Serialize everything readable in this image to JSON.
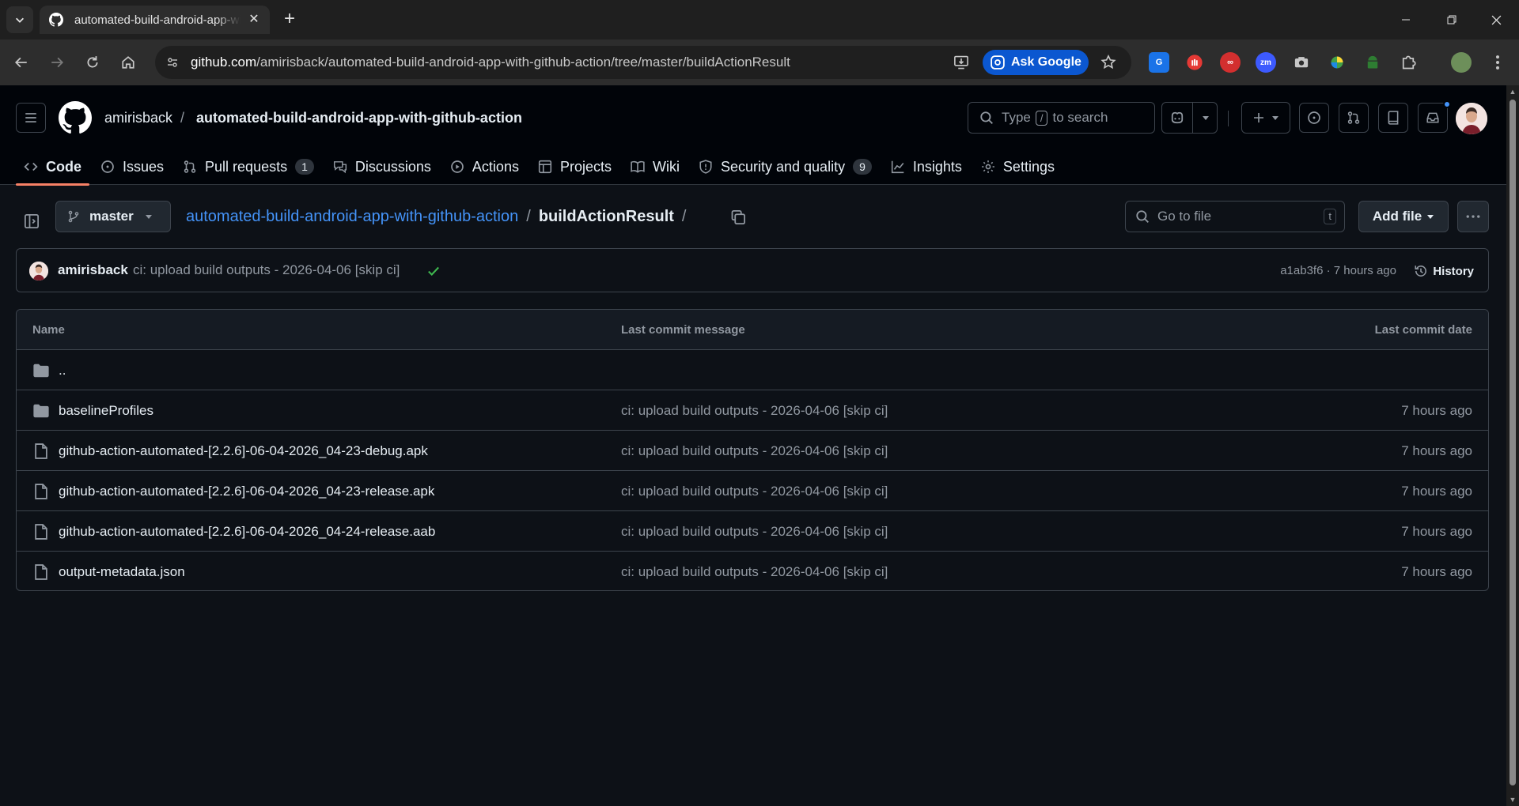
{
  "browser": {
    "tab_title": "automated-build-android-app-with-github-action",
    "url_host": "github.com",
    "url_path": "/amirisback/automated-build-android-app-with-github-action/tree/master/buildActionResult",
    "ask_google_label": "Ask Google",
    "colors": {
      "accent": "#0b57d0"
    }
  },
  "header": {
    "owner": "amirisback",
    "separator": "/",
    "repo": "automated-build-android-app-with-github-action",
    "search_prefix": "Type",
    "search_key": "/",
    "search_suffix": "to search"
  },
  "repo_nav": {
    "items": [
      {
        "label": "Code",
        "icon": "code-icon",
        "active": true
      },
      {
        "label": "Issues",
        "icon": "issue-icon"
      },
      {
        "label": "Pull requests",
        "icon": "pull-request-icon",
        "count": "1"
      },
      {
        "label": "Discussions",
        "icon": "discussion-icon"
      },
      {
        "label": "Actions",
        "icon": "play-icon"
      },
      {
        "label": "Projects",
        "icon": "table-icon"
      },
      {
        "label": "Wiki",
        "icon": "book-icon"
      },
      {
        "label": "Security and quality",
        "icon": "shield-icon",
        "count": "9"
      },
      {
        "label": "Insights",
        "icon": "graph-icon"
      },
      {
        "label": "Settings",
        "icon": "gear-icon"
      }
    ]
  },
  "breadcrumb": {
    "branch": "master",
    "repo_link": "automated-build-android-app-with-github-action",
    "sep": "/",
    "current": "buildActionResult",
    "trailing_sep": "/"
  },
  "file_actions": {
    "goto_placeholder": "Go to file",
    "goto_key": "t",
    "add_file_label": "Add file"
  },
  "latest_commit": {
    "author": "amirisback",
    "message": "ci: upload build outputs - 2026-04-06 [skip ci]",
    "sha_and_time": "a1ab3f6 · 7 hours ago",
    "history_label": "History",
    "status_color": "#3fb950"
  },
  "file_table": {
    "headers": {
      "name": "Name",
      "message": "Last commit message",
      "date": "Last commit date"
    },
    "rows": [
      {
        "type": "folder",
        "name": "..",
        "message": "",
        "date": ""
      },
      {
        "type": "folder",
        "name": "baselineProfiles",
        "message": "ci: upload build outputs - 2026-04-06 [skip ci]",
        "date": "7 hours ago"
      },
      {
        "type": "file",
        "name": "github-action-automated-[2.2.6]-06-04-2026_04-23-debug.apk",
        "message": "ci: upload build outputs - 2026-04-06 [skip ci]",
        "date": "7 hours ago"
      },
      {
        "type": "file",
        "name": "github-action-automated-[2.2.6]-06-04-2026_04-23-release.apk",
        "message": "ci: upload build outputs - 2026-04-06 [skip ci]",
        "date": "7 hours ago"
      },
      {
        "type": "file",
        "name": "github-action-automated-[2.2.6]-06-04-2026_04-24-release.aab",
        "message": "ci: upload build outputs - 2026-04-06 [skip ci]",
        "date": "7 hours ago"
      },
      {
        "type": "file",
        "name": "output-metadata.json",
        "message": "ci: upload build outputs - 2026-04-06 [skip ci]",
        "date": "7 hours ago"
      }
    ]
  },
  "theme": {
    "background": "#0d1117",
    "header_bg": "#010409",
    "link": "#4493f8",
    "tab_underline": "#f78166",
    "muted_text": "#9198a1"
  }
}
